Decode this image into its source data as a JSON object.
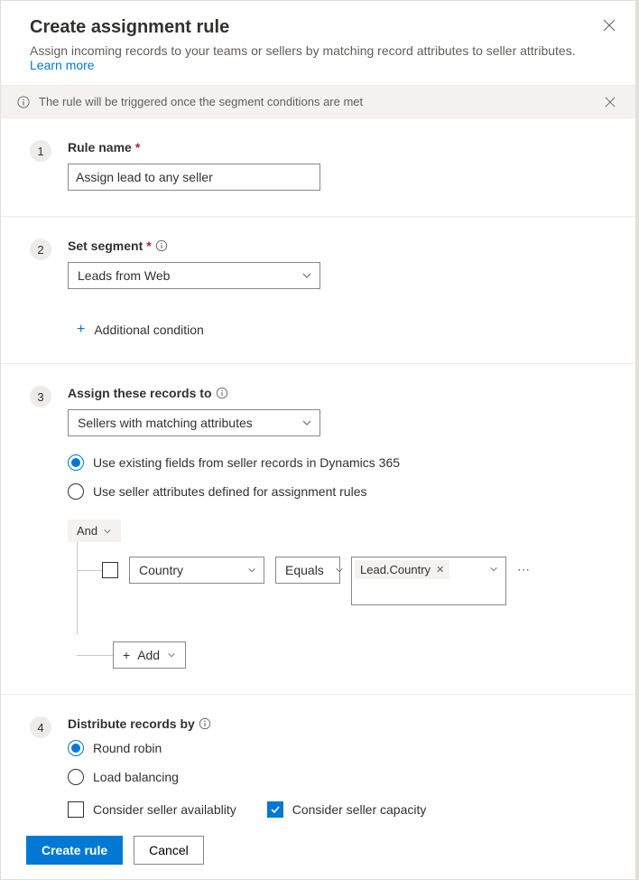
{
  "header": {
    "title": "Create assignment rule",
    "subtitle": "Assign incoming records to your teams or sellers by matching record attributes to seller attributes. ",
    "learn_more": "Learn more"
  },
  "info_bar": {
    "text": "The rule will be triggered once the segment conditions are met"
  },
  "step1": {
    "num": "1",
    "label": "Rule name",
    "value": "Assign lead to any seller"
  },
  "step2": {
    "num": "2",
    "label": "Set segment",
    "value": "Leads from Web",
    "additional": "Additional condition"
  },
  "step3": {
    "num": "3",
    "label": "Assign these records to",
    "select_value": "Sellers with matching attributes",
    "radio1": "Use existing fields from seller records in Dynamics 365",
    "radio2": "Use seller attributes defined for assignment rules",
    "and_label": "And",
    "condition": {
      "field": "Country",
      "operator": "Equals",
      "value": "Lead.Country"
    },
    "add_label": "Add"
  },
  "step4": {
    "num": "4",
    "label": "Distribute records by",
    "radio1": "Round robin",
    "radio2": "Load balancing",
    "check1": "Consider seller availablity",
    "check2": "Consider seller capacity"
  },
  "footer": {
    "create": "Create rule",
    "cancel": "Cancel"
  }
}
